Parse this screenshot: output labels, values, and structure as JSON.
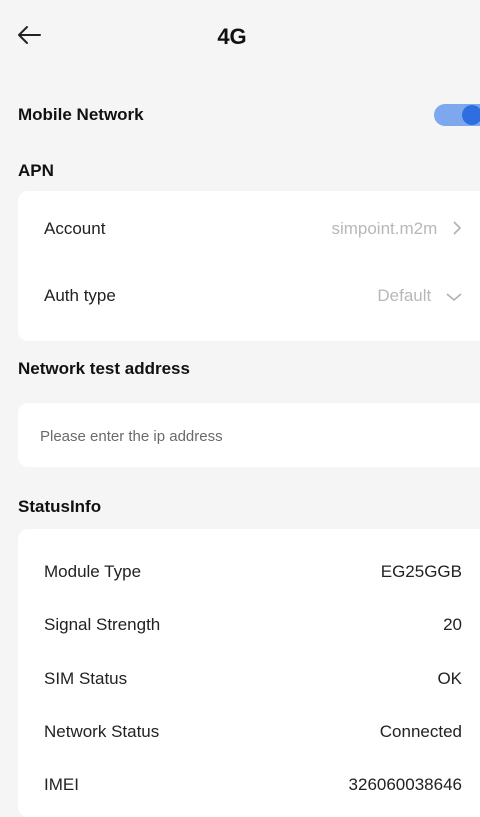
{
  "header": {
    "title": "4G"
  },
  "mobile_network": {
    "label": "Mobile Network",
    "enabled": true
  },
  "apn": {
    "label": "APN",
    "account": {
      "label": "Account",
      "value": "simpoint.m2m"
    },
    "auth_type": {
      "label": "Auth type",
      "value": "Default"
    }
  },
  "network_test": {
    "label": "Network test address",
    "placeholder": "Please enter the ip address"
  },
  "status_info": {
    "label": "StatusInfo",
    "module_type": {
      "label": "Module Type",
      "value": "EG25GGB"
    },
    "signal_strength": {
      "label": "Signal Strength",
      "value": "20"
    },
    "sim_status": {
      "label": "SIM Status",
      "value": "OK"
    },
    "network_status": {
      "label": "Network Status",
      "value": "Connected"
    },
    "imei": {
      "label": "IMEI",
      "value": "326060038646"
    }
  },
  "colors": {
    "accent": "#2f6ee0",
    "toggle_track": "#7ea8ee",
    "background": "#f5f5f5"
  },
  "icons": [
    "back-arrow-icon",
    "chevron-right-icon",
    "chevron-down-icon"
  ]
}
